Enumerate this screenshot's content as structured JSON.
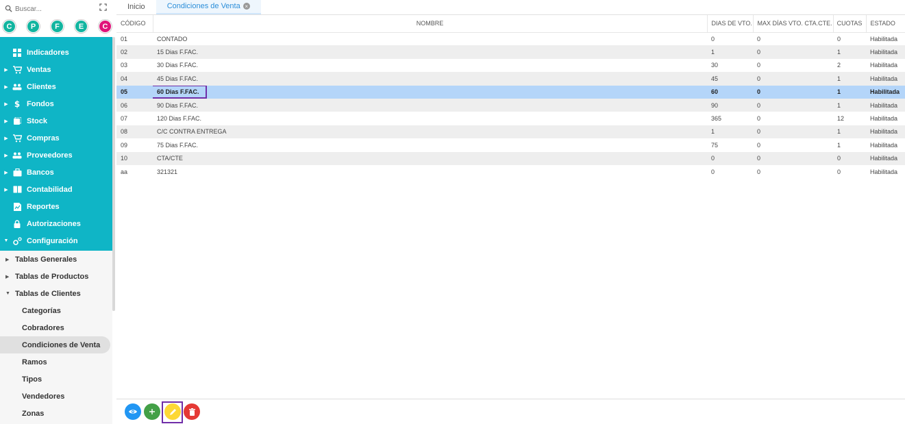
{
  "sidebar": {
    "search_placeholder": "Buscar...",
    "avatars": [
      {
        "letter": "C",
        "color": "#12b5a0"
      },
      {
        "letter": "P",
        "color": "#12b5a0"
      },
      {
        "letter": "F",
        "color": "#12b5a0"
      },
      {
        "letter": "E",
        "color": "#12b5a0"
      },
      {
        "letter": "C",
        "color": "#e0147a"
      }
    ],
    "menu": [
      {
        "label": "Indicadores",
        "icon": "dashboard-icon",
        "arrow": ""
      },
      {
        "label": "Ventas",
        "icon": "cart-icon",
        "arrow": "▶"
      },
      {
        "label": "Clientes",
        "icon": "people-icon",
        "arrow": "▶"
      },
      {
        "label": "Fondos",
        "icon": "dollar-icon",
        "arrow": "▶"
      },
      {
        "label": "Stock",
        "icon": "boxes-icon",
        "arrow": "▶"
      },
      {
        "label": "Compras",
        "icon": "cart-arrow-icon",
        "arrow": "▶"
      },
      {
        "label": "Proveedores",
        "icon": "people-icon",
        "arrow": "▶"
      },
      {
        "label": "Bancos",
        "icon": "briefcase-icon",
        "arrow": "▶"
      },
      {
        "label": "Contabilidad",
        "icon": "book-icon",
        "arrow": "▶"
      },
      {
        "label": "Reportes",
        "icon": "report-icon",
        "arrow": ""
      },
      {
        "label": "Autorizaciones",
        "icon": "lock-icon",
        "arrow": ""
      },
      {
        "label": "Configuración",
        "icon": "gears-icon",
        "arrow": "▼"
      }
    ],
    "sub_groups": [
      {
        "label": "Tablas Generales",
        "arrow": "▶"
      },
      {
        "label": "Tablas de Productos",
        "arrow": "▶"
      },
      {
        "label": "Tablas de Clientes",
        "arrow": "▼"
      }
    ],
    "sub_items": [
      "Categorías",
      "Cobradores",
      "Condiciones de Venta",
      "Ramos",
      "Tipos",
      "Vendedores",
      "Zonas"
    ],
    "active_sub_item": "Condiciones de Venta"
  },
  "tabs": [
    {
      "label": "Inicio",
      "active": false
    },
    {
      "label": "Condiciones de Venta",
      "active": true
    }
  ],
  "table": {
    "columns": [
      "CÓDIGO",
      "NOMBRE",
      "DIAS DE VTO.",
      "MAX DÍAS VTO. CTA.CTE.",
      "CUOTAS",
      "ESTADO"
    ],
    "rows": [
      [
        "01",
        "CONTADO",
        "0",
        "0",
        "0",
        "Habilitada"
      ],
      [
        "02",
        "15 Dias F.FAC.",
        "1",
        "0",
        "1",
        "Habilitada"
      ],
      [
        "03",
        "30 Dias F.FAC.",
        "30",
        "0",
        "2",
        "Habilitada"
      ],
      [
        "04",
        "45 Dias F.FAC.",
        "45",
        "0",
        "1",
        "Habilitada"
      ],
      [
        "05",
        "60 Dias F.FAC.",
        "60",
        "0",
        "1",
        "Habilitada"
      ],
      [
        "06",
        "90 Dias F.FAC.",
        "90",
        "0",
        "1",
        "Habilitada"
      ],
      [
        "07",
        "120 Dias F.FAC.",
        "365",
        "0",
        "12",
        "Habilitada"
      ],
      [
        "08",
        "C/C CONTRA ENTREGA",
        "1",
        "0",
        "1",
        "Habilitada"
      ],
      [
        "09",
        "75 Dias F.FAC.",
        "75",
        "0",
        "1",
        "Habilitada"
      ],
      [
        "10",
        "CTA/CTE",
        "0",
        "0",
        "0",
        "Habilitada"
      ],
      [
        "aa",
        "321321",
        "0",
        "0",
        "0",
        "Habilitada"
      ]
    ],
    "selected_row": 4
  },
  "actions": [
    {
      "name": "view-button",
      "color": "#2196f3",
      "icon": "eye-icon"
    },
    {
      "name": "add-button",
      "color": "#43a047",
      "icon": "plus-icon"
    },
    {
      "name": "edit-button",
      "color": "#fdd835",
      "icon": "pencil-icon"
    },
    {
      "name": "delete-button",
      "color": "#e53935",
      "icon": "trash-icon"
    }
  ]
}
